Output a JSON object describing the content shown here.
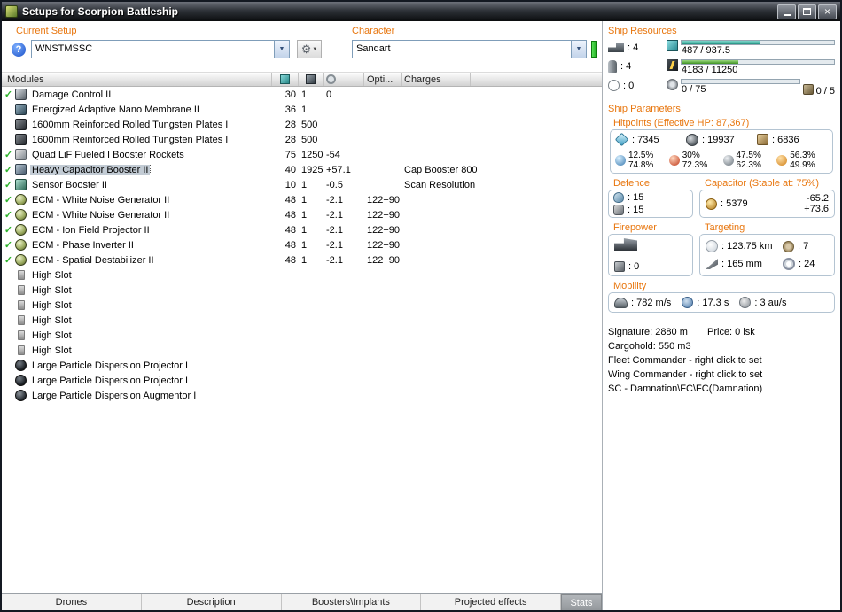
{
  "window": {
    "title": "Setups for Scorpion Battleship"
  },
  "setup": {
    "label": "Current Setup",
    "value": "WNSTMSSC"
  },
  "character": {
    "label": "Character",
    "value": "Sandart"
  },
  "table": {
    "modules_header": "Modules",
    "opti_header": "Opti...",
    "charges_header": "Charges",
    "rows": [
      {
        "checked": true,
        "icon": "damage-control",
        "name": "Damage Control II",
        "cpu": "30",
        "pg": "1",
        "cap": "0",
        "opti": "",
        "charges": ""
      },
      {
        "checked": false,
        "icon": "nano-membrane",
        "name": "Energized Adaptive Nano Membrane II",
        "cpu": "36",
        "pg": "1",
        "cap": "",
        "opti": "",
        "charges": ""
      },
      {
        "checked": false,
        "icon": "armor-plate",
        "name": "1600mm Reinforced Rolled Tungsten Plates I",
        "cpu": "28",
        "pg": "500",
        "cap": "",
        "opti": "",
        "charges": ""
      },
      {
        "checked": false,
        "icon": "armor-plate",
        "name": "1600mm Reinforced Rolled Tungsten Plates I",
        "cpu": "28",
        "pg": "500",
        "cap": "",
        "opti": "",
        "charges": ""
      },
      {
        "checked": true,
        "icon": "mwd",
        "name": "Quad LiF Fueled I Booster Rockets",
        "cpu": "75",
        "pg": "1250",
        "cap": "-54",
        "opti": "",
        "charges": ""
      },
      {
        "checked": true,
        "icon": "cap-booster",
        "name": "Heavy Capacitor Booster II",
        "cpu": "40",
        "pg": "1925",
        "cap": "+57.1",
        "opti": "",
        "charges": "Cap Booster 800",
        "selected": true
      },
      {
        "checked": true,
        "icon": "sensor-booster",
        "name": "Sensor Booster II",
        "cpu": "10",
        "pg": "1",
        "cap": "-0.5",
        "opti": "",
        "charges": "Scan Resolution"
      },
      {
        "checked": true,
        "icon": "ecm",
        "name": "ECM - White Noise Generator II",
        "cpu": "48",
        "pg": "1",
        "cap": "-2.1",
        "opti": "122+90",
        "charges": ""
      },
      {
        "checked": true,
        "icon": "ecm",
        "name": "ECM - White Noise Generator II",
        "cpu": "48",
        "pg": "1",
        "cap": "-2.1",
        "opti": "122+90",
        "charges": ""
      },
      {
        "checked": true,
        "icon": "ecm",
        "name": "ECM - Ion Field Projector II",
        "cpu": "48",
        "pg": "1",
        "cap": "-2.1",
        "opti": "122+90",
        "charges": ""
      },
      {
        "checked": true,
        "icon": "ecm",
        "name": "ECM - Phase Inverter II",
        "cpu": "48",
        "pg": "1",
        "cap": "-2.1",
        "opti": "122+90",
        "charges": ""
      },
      {
        "checked": true,
        "icon": "ecm",
        "name": "ECM - Spatial Destabilizer II",
        "cpu": "48",
        "pg": "1",
        "cap": "-2.1",
        "opti": "122+90",
        "charges": ""
      },
      {
        "checked": false,
        "icon": "high-slot",
        "name": "High Slot",
        "empty": true
      },
      {
        "checked": false,
        "icon": "high-slot",
        "name": "High Slot",
        "empty": true
      },
      {
        "checked": false,
        "icon": "high-slot",
        "name": "High Slot",
        "empty": true
      },
      {
        "checked": false,
        "icon": "high-slot",
        "name": "High Slot",
        "empty": true
      },
      {
        "checked": false,
        "icon": "high-slot",
        "name": "High Slot",
        "empty": true
      },
      {
        "checked": false,
        "icon": "high-slot",
        "name": "High Slot",
        "empty": true
      },
      {
        "checked": false,
        "icon": "rig-projector",
        "name": "Large Particle Dispersion Projector I"
      },
      {
        "checked": false,
        "icon": "rig-projector",
        "name": "Large Particle Dispersion Projector I"
      },
      {
        "checked": false,
        "icon": "rig-augmentor",
        "name": "Large Particle Dispersion Augmentor I"
      }
    ]
  },
  "resources": {
    "label": "Ship Resources",
    "turret_hardpoints": "4",
    "launcher_hardpoints": "4",
    "upgrade_hardpoints": "0",
    "cpu_text": "487 / 937.5",
    "cpu_pct": 52,
    "powergrid_text": "4183 / 11250",
    "powergrid_pct": 37,
    "calibration_text": "0 / 75",
    "calibration_pct": 0,
    "rig_slots": "0 / 5"
  },
  "parameters": {
    "label": "Ship Parameters",
    "hitpoints_label": "Hitpoints (Effective HP: 87,367)",
    "shield_hp": "7345",
    "armor_hp": "19937",
    "hull_hp": "6836",
    "resists": [
      {
        "shield": "12.5%",
        "armor": "74.8%"
      },
      {
        "shield": "30%",
        "armor": "72.3%"
      },
      {
        "shield": "47.5%",
        "armor": "62.3%"
      },
      {
        "shield": "56.3%",
        "armor": "49.9%"
      }
    ],
    "defence": {
      "label": "Defence",
      "value1": "15",
      "value2": "15"
    },
    "capacitor": {
      "label": "Capacitor (Stable at: 75%)",
      "capacity": "5379",
      "usage": "-65.2",
      "recharge": "+73.6"
    },
    "firepower": {
      "label": "Firepower",
      "volley": "0"
    },
    "targeting": {
      "label": "Targeting",
      "range": "123.75 km",
      "max_targets": "7",
      "scan_resolution": "165 mm",
      "sensor_strength": "24"
    },
    "mobility": {
      "label": "Mobility",
      "speed": "782 m/s",
      "align_time": "17.3 s",
      "warp_speed": "3 au/s"
    }
  },
  "info": {
    "signature": "Signature: 2880 m",
    "price": "Price: 0 isk",
    "cargohold": "Cargohold: 550 m3",
    "fleet_commander": "Fleet Commander - right click to set",
    "wing_commander": "Wing Commander - right click to set",
    "squad_commander": "SC - Damnation\\FC\\FC(Damnation)"
  },
  "tabs": [
    {
      "label": "Drones",
      "style": "tab"
    },
    {
      "label": "Description",
      "style": "tab"
    },
    {
      "label": "Boosters\\Implants",
      "style": "tab"
    },
    {
      "label": "Projected effects",
      "style": "tab"
    },
    {
      "label": "Stats",
      "style": "button"
    }
  ]
}
